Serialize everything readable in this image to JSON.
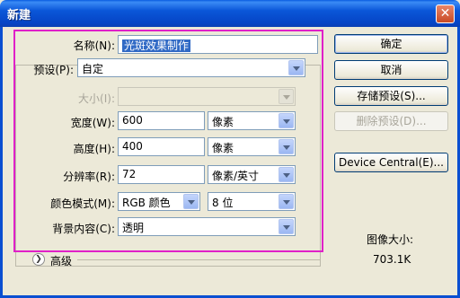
{
  "window": {
    "title": "新建",
    "close_icon": "close-icon"
  },
  "form": {
    "name_label": "名称(N):",
    "name_value": "光斑效果制作",
    "preset_label": "预设(P):",
    "preset_value": "自定",
    "size_label": "大小(I):",
    "size_value": "",
    "width_label": "宽度(W):",
    "width_value": "600",
    "width_unit": "像素",
    "height_label": "高度(H):",
    "height_value": "400",
    "height_unit": "像素",
    "resolution_label": "分辨率(R):",
    "resolution_value": "72",
    "resolution_unit": "像素/英寸",
    "color_mode_label": "颜色模式(M):",
    "color_mode_value": "RGB 颜色",
    "bit_depth_value": "8 位",
    "background_label": "背景内容(C):",
    "background_value": "透明",
    "advanced_label": "高级"
  },
  "buttons": {
    "ok": "确定",
    "cancel": "取消",
    "save_preset": "存储预设(S)...",
    "delete_preset": "删除预设(D)...",
    "device_central": "Device Central(E)..."
  },
  "info": {
    "image_size_label": "图像大小:",
    "image_size_value": "703.1K"
  },
  "colors": {
    "highlight": "#e020c8",
    "titlebar": "#0a56d8"
  }
}
